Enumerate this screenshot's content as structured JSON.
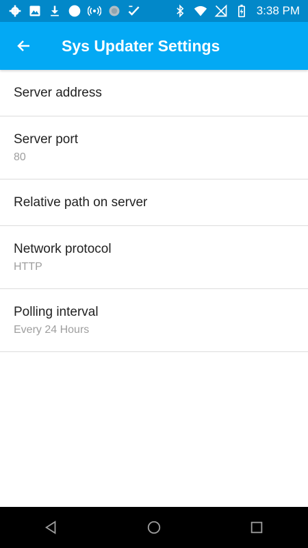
{
  "status_bar": {
    "time": "3:38 PM",
    "left_icons": [
      "settings-icon",
      "image-icon",
      "download-icon",
      "circle-icon",
      "broadcast-icon",
      "sync-icon",
      "checklist-icon"
    ],
    "right_icons": [
      "bluetooth-icon",
      "wifi-icon",
      "signal-off-icon",
      "battery-charging-icon"
    ]
  },
  "app_bar": {
    "back_icon": "arrow-back-icon",
    "title": "Sys Updater Settings"
  },
  "settings": [
    {
      "title": "Server address",
      "summary": ""
    },
    {
      "title": "Server port",
      "summary": "80"
    },
    {
      "title": "Relative path on server",
      "summary": ""
    },
    {
      "title": "Network protocol",
      "summary": "HTTP"
    },
    {
      "title": "Polling interval",
      "summary": "Every 24 Hours"
    }
  ],
  "nav_bar": {
    "icons": [
      "back-triangle-icon",
      "home-circle-icon",
      "recents-square-icon"
    ]
  },
  "colors": {
    "status_bar": "#0288c9",
    "app_bar": "#03a9f4",
    "title_text": "#212121",
    "summary_text": "#9e9e9e",
    "divider": "#dcdcdc"
  }
}
